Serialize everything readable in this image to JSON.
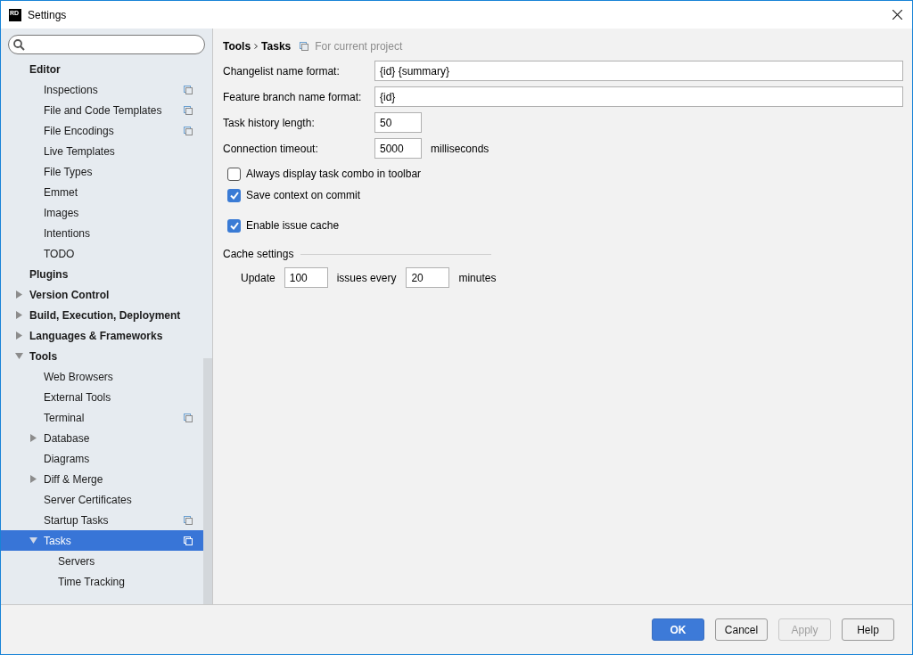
{
  "window": {
    "title": "Settings",
    "app_icon_text": "RD"
  },
  "tree": [
    {
      "label": "Editor",
      "bold": true,
      "selected": false,
      "children": [
        {
          "label": "Inspections",
          "selected": false,
          "project_icon": true
        },
        {
          "label": "File and Code Templates",
          "selected": false,
          "project_icon": true
        },
        {
          "label": "File Encodings",
          "selected": false,
          "project_icon": true
        },
        {
          "label": "Live Templates",
          "selected": false,
          "project_icon": false
        },
        {
          "label": "File Types",
          "selected": false,
          "project_icon": false
        },
        {
          "label": "Emmet",
          "selected": false,
          "project_icon": false
        },
        {
          "label": "Images",
          "selected": false,
          "project_icon": false
        },
        {
          "label": "Intentions",
          "selected": false,
          "project_icon": false
        },
        {
          "label": "TODO",
          "selected": false,
          "project_icon": false
        }
      ]
    },
    {
      "label": "Plugins",
      "bold": true,
      "selected": false
    },
    {
      "label": "Version Control",
      "bold": true,
      "selected": false,
      "expanded": false
    },
    {
      "label": "Build, Execution, Deployment",
      "bold": true,
      "selected": false,
      "expanded": false
    },
    {
      "label": "Languages & Frameworks",
      "bold": true,
      "selected": false,
      "expanded": false
    },
    {
      "label": "Tools",
      "bold": true,
      "selected": false,
      "expanded": true,
      "children": [
        {
          "label": "Web Browsers",
          "selected": false,
          "project_icon": false
        },
        {
          "label": "External Tools",
          "selected": false,
          "project_icon": false
        },
        {
          "label": "Terminal",
          "selected": false,
          "project_icon": true
        },
        {
          "label": "Database",
          "selected": false,
          "project_icon": false,
          "expanded": false
        },
        {
          "label": "Diagrams",
          "selected": false,
          "project_icon": false
        },
        {
          "label": "Diff & Merge",
          "selected": false,
          "project_icon": false,
          "expanded": false
        },
        {
          "label": "Server Certificates",
          "selected": false,
          "project_icon": false
        },
        {
          "label": "Startup Tasks",
          "selected": false,
          "project_icon": true
        },
        {
          "label": "Tasks",
          "selected": true,
          "project_icon": true,
          "expanded": true,
          "children": [
            {
              "label": "Servers",
              "selected": false
            },
            {
              "label": "Time Tracking",
              "selected": false
            }
          ]
        }
      ]
    }
  ],
  "breadcrumb": [
    "Tools",
    "Tasks"
  ],
  "scope_note": "For current project",
  "fields": [
    {
      "kind": "wide",
      "label": "Changelist name format:",
      "value": "{id} {summary}"
    },
    {
      "kind": "wide",
      "label": "Feature branch name format:",
      "value": "{id}"
    },
    {
      "kind": "short",
      "label": "Task history length:",
      "value": "50"
    },
    {
      "kind": "short",
      "label": "Connection timeout:",
      "value": "5000",
      "suffix": "milliseconds"
    }
  ],
  "checkboxes": [
    {
      "label": "Always display task combo in toolbar",
      "checked": false
    },
    {
      "label": "Save context on commit",
      "checked": true
    },
    {
      "label": "Enable issue cache",
      "checked": true
    }
  ],
  "cache_settings": {
    "title": "Cache settings",
    "update_label": "Update",
    "count": "100",
    "middle_label": "issues every",
    "interval": "20",
    "unit": "minutes"
  },
  "buttons": [
    {
      "label": "OK",
      "default": true,
      "disabled": false
    },
    {
      "label": "Cancel",
      "default": false,
      "disabled": false
    },
    {
      "label": "Apply",
      "default": false,
      "disabled": true
    },
    {
      "label": "Help",
      "default": false,
      "disabled": false
    }
  ]
}
